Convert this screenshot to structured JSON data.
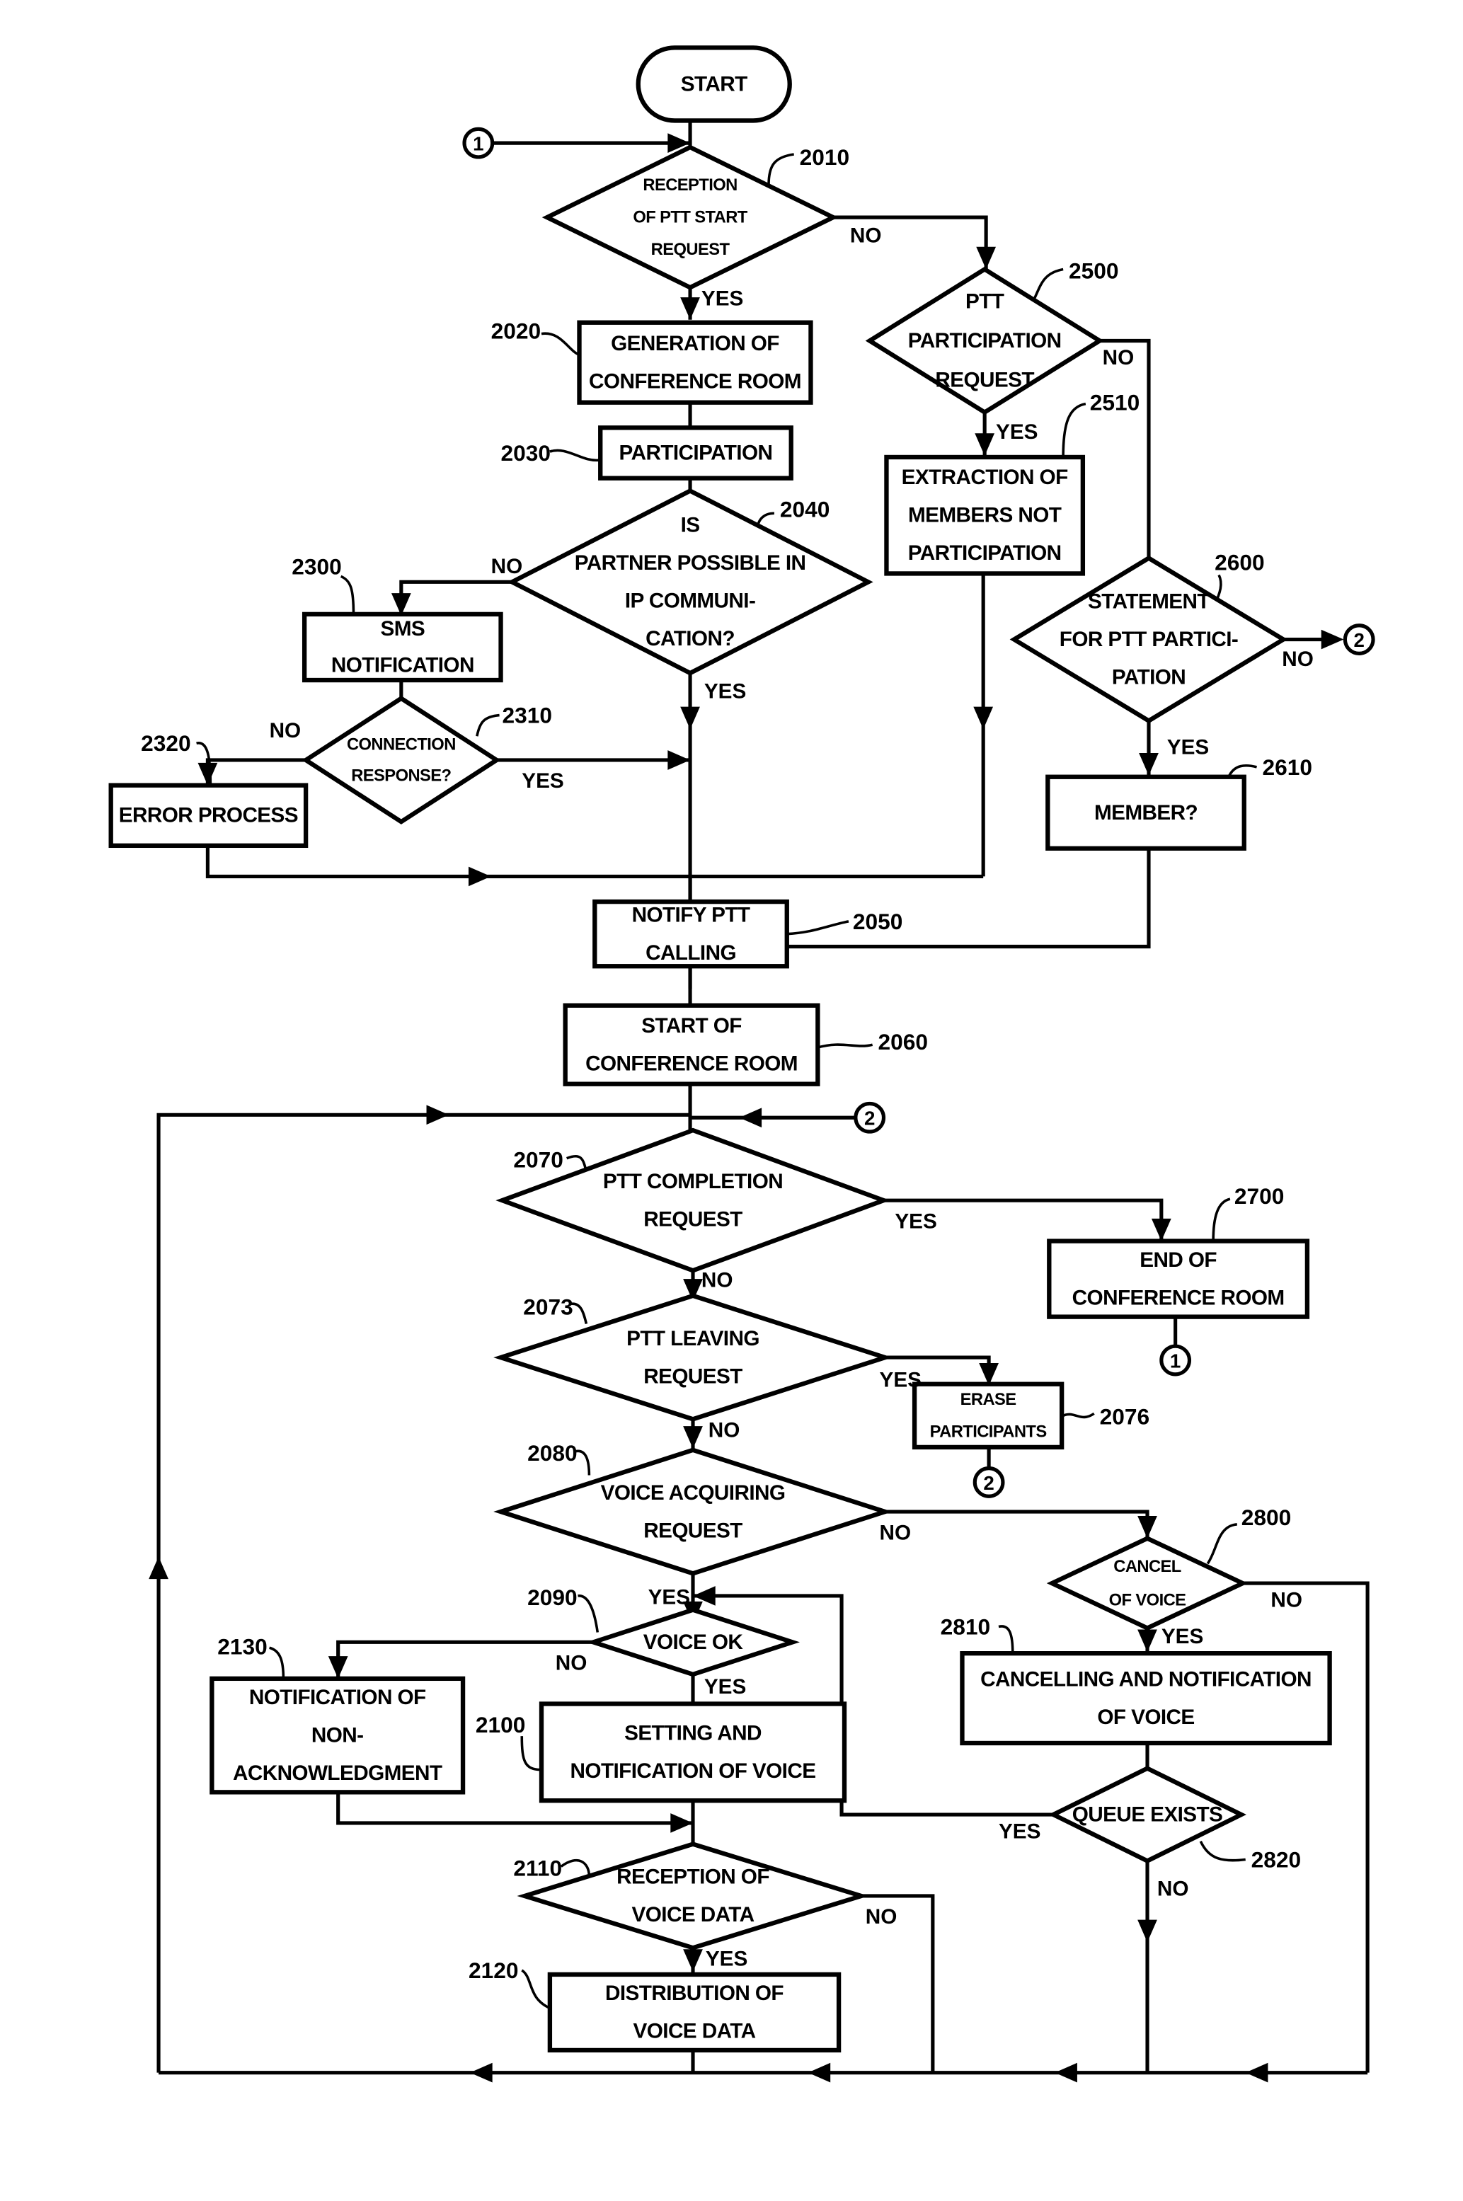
{
  "diagram": {
    "type": "flowchart",
    "nodes": {
      "start": {
        "lines": [
          "START"
        ]
      },
      "n2010": {
        "ref": "2010",
        "lines": [
          "RECEPTION",
          "OF PTT START",
          "REQUEST"
        ]
      },
      "n2020": {
        "ref": "2020",
        "lines": [
          "GENERATION OF",
          "CONFERENCE ROOM"
        ]
      },
      "n2030": {
        "ref": "2030",
        "lines": [
          "PARTICIPATION"
        ]
      },
      "n2040": {
        "ref": "2040",
        "lines": [
          "IS",
          "PARTNER POSSIBLE IN",
          "IP COMMUNI-",
          "CATION?"
        ]
      },
      "n2300": {
        "ref": "2300",
        "lines": [
          "SMS",
          "NOTIFICATION"
        ]
      },
      "n2310": {
        "ref": "2310",
        "lines": [
          "CONNECTION",
          "RESPONSE?"
        ]
      },
      "n2320": {
        "ref": "2320",
        "lines": [
          "ERROR PROCESS"
        ]
      },
      "n2500": {
        "ref": "2500",
        "lines": [
          "PTT",
          "PARTICIPATION",
          "REQUEST"
        ]
      },
      "n2510": {
        "ref": "2510",
        "lines": [
          "EXTRACTION OF",
          "MEMBERS NOT",
          "PARTICIPATION"
        ]
      },
      "n2600": {
        "ref": "2600",
        "lines": [
          "STATEMENT",
          "FOR PTT PARTICI-",
          "PATION"
        ]
      },
      "n2610": {
        "ref": "2610",
        "lines": [
          "MEMBER?"
        ]
      },
      "n2050": {
        "ref": "2050",
        "lines": [
          "NOTIFY PTT",
          "CALLING"
        ]
      },
      "n2060": {
        "ref": "2060",
        "lines": [
          "START OF",
          "CONFERENCE ROOM"
        ]
      },
      "n2070": {
        "ref": "2070",
        "lines": [
          "PTT COMPLETION",
          "REQUEST"
        ]
      },
      "n2700": {
        "ref": "2700",
        "lines": [
          "END OF",
          "CONFERENCE ROOM"
        ]
      },
      "n2073": {
        "ref": "2073",
        "lines": [
          "PTT LEAVING",
          "REQUEST"
        ]
      },
      "n2076": {
        "ref": "2076",
        "lines": [
          "ERASE",
          "PARTICIPANTS"
        ]
      },
      "n2080": {
        "ref": "2080",
        "lines": [
          "VOICE ACQUIRING",
          "REQUEST"
        ]
      },
      "n2800": {
        "ref": "2800",
        "lines": [
          "CANCEL",
          "OF VOICE"
        ]
      },
      "n2810": {
        "ref": "2810",
        "lines": [
          "CANCELLING AND NOTIFICATION",
          "OF VOICE"
        ]
      },
      "n2820": {
        "ref": "2820",
        "lines": [
          "QUEUE EXISTS"
        ]
      },
      "n2090": {
        "ref": "2090",
        "lines": [
          "VOICE OK"
        ]
      },
      "n2130": {
        "ref": "2130",
        "lines": [
          "NOTIFICATION OF",
          "NON-",
          "ACKNOWLEDGMENT"
        ]
      },
      "n2100": {
        "ref": "2100",
        "lines": [
          "SETTING AND",
          "NOTIFICATION OF VOICE"
        ]
      },
      "n2110": {
        "ref": "2110",
        "lines": [
          "RECEPTION OF",
          "VOICE DATA"
        ]
      },
      "n2120": {
        "ref": "2120",
        "lines": [
          "DISTRIBUTION OF",
          "VOICE DATA"
        ]
      }
    },
    "connectors": {
      "c1": "1",
      "c2": "2"
    },
    "branch_labels": {
      "yes": "YES",
      "no": "NO"
    }
  }
}
